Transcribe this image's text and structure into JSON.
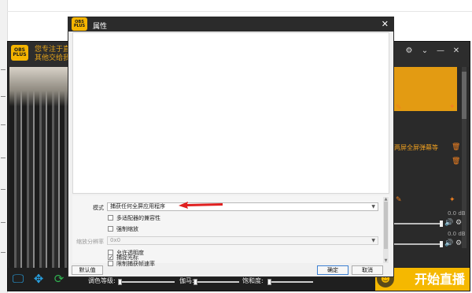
{
  "app": {
    "logo": {
      "line1": "OBS",
      "line2": "PLUS"
    },
    "notice": [
      "您专注于直",
      "其他交给我"
    ],
    "window_controls": {
      "settings": "⚙",
      "dropdown": "⌄",
      "minimize": "—",
      "close": "✕"
    },
    "scene_label": "两屏全屏弹幕等",
    "volumes": [
      "0.0 dB",
      "0.0 dB"
    ],
    "go_live": "开始直播",
    "tone": {
      "color_level": "调色等级:",
      "gamma": "伽马:",
      "saturation": "饱和度:"
    }
  },
  "dialog": {
    "logo": {
      "line1": "OBS",
      "line2": "PLUS"
    },
    "title": "属性",
    "close": "✕",
    "mode_label": "模式",
    "mode_value": "捕获任何全屏应用程序",
    "checkboxes": [
      {
        "label": "多适配器的兼容性",
        "checked": false
      },
      {
        "label": "强制缩放",
        "checked": false
      }
    ],
    "scale_label": "缩放分辨率",
    "scale_value": "0x0",
    "checkboxes2": [
      {
        "label": "允许透明度",
        "checked": false
      },
      {
        "label": "限制捕获帧速率",
        "checked": false
      },
      {
        "label": "捕捉光标",
        "checked": true
      }
    ],
    "defaults_button": "默认值",
    "ok_button": "确定",
    "cancel_button": "取消",
    "arrow_color": "#e02020"
  }
}
